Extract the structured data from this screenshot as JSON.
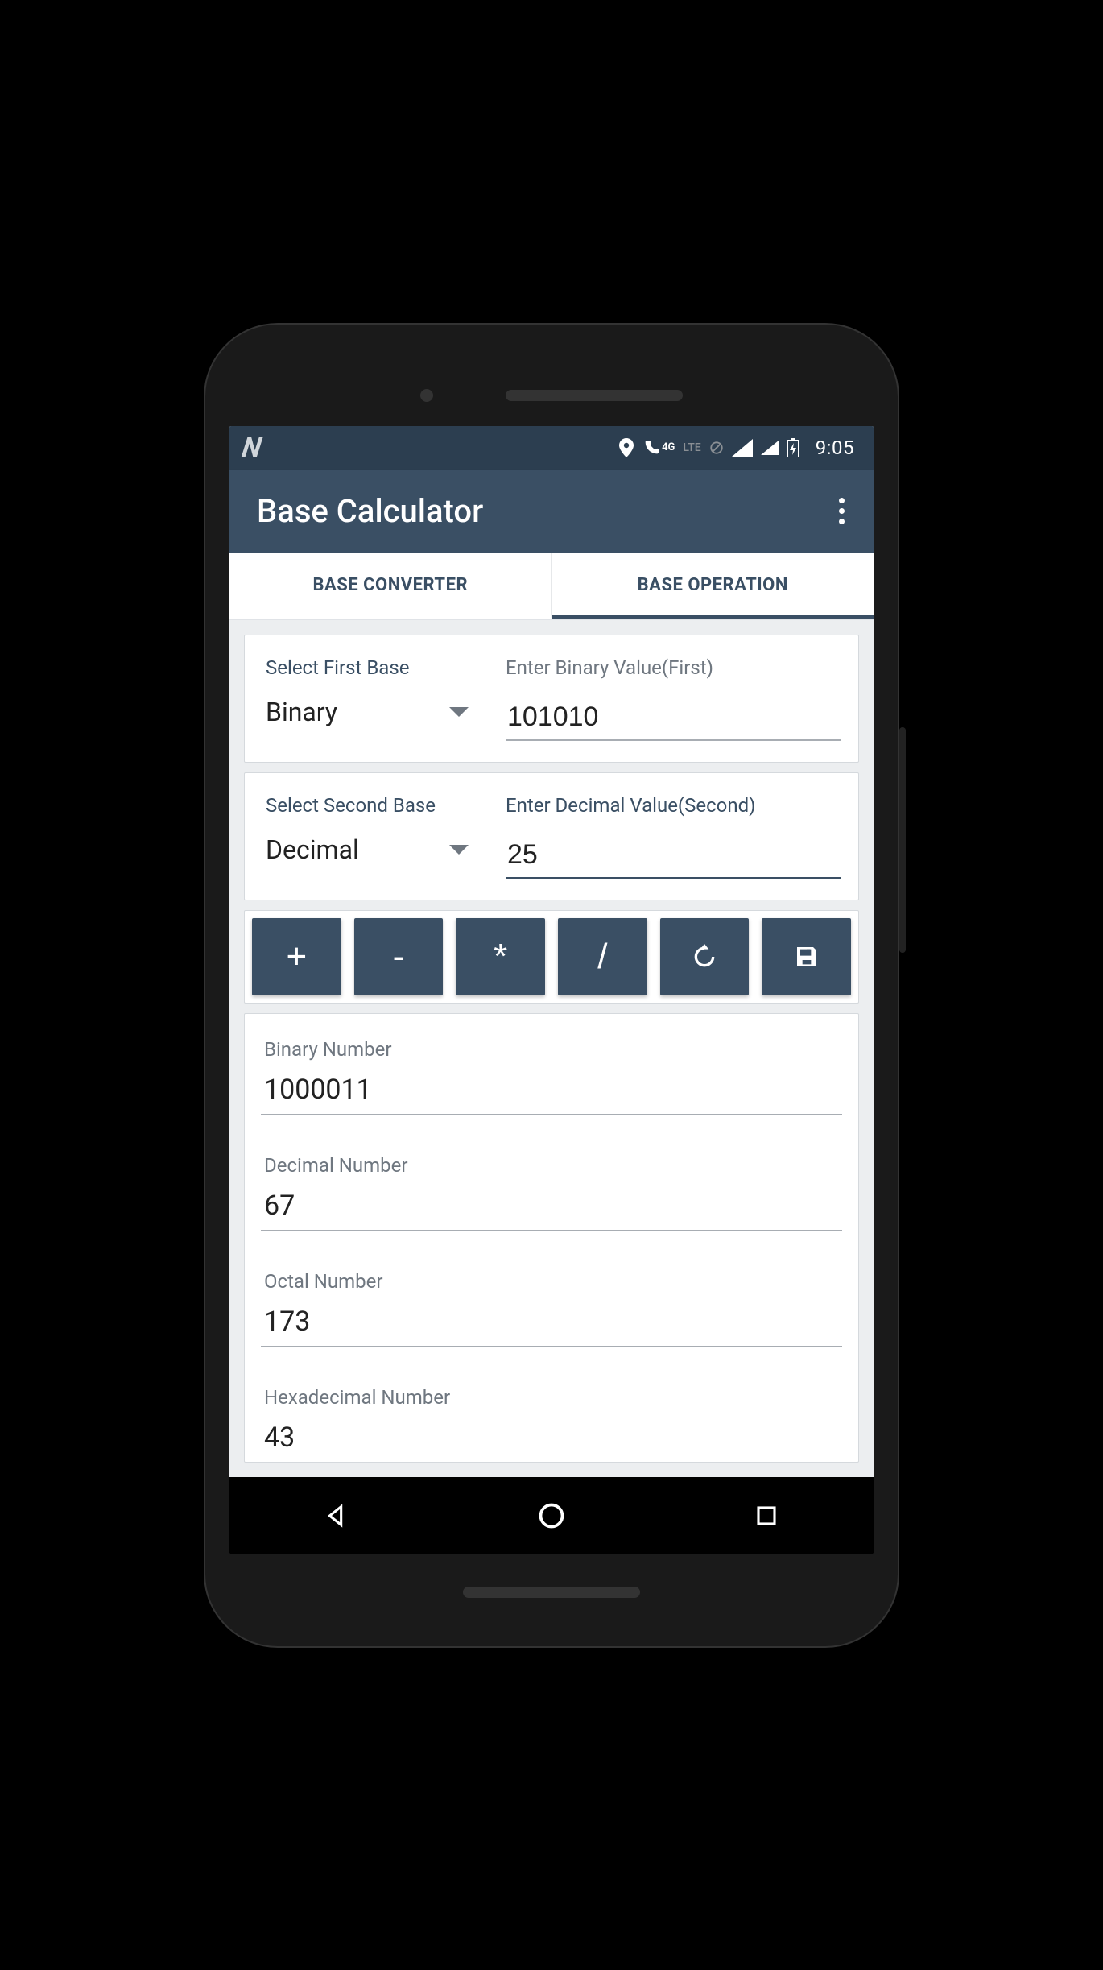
{
  "status": {
    "carrier_glyph": "N",
    "lte_label": "LTE",
    "time": "9:05"
  },
  "app_bar": {
    "title": "Base Calculator"
  },
  "tabs": [
    {
      "label": "BASE CONVERTER",
      "active": false
    },
    {
      "label": "BASE OPERATION",
      "active": true
    }
  ],
  "first_base": {
    "select_label": "Select First Base",
    "select_value": "Binary",
    "input_label": "Enter Binary Value(First)",
    "input_value": "101010"
  },
  "second_base": {
    "select_label": "Select Second Base",
    "select_value": "Decimal",
    "input_label": "Enter Decimal Value(Second)",
    "input_value": "25"
  },
  "operations": {
    "add": "+",
    "subtract": "-",
    "multiply": "*",
    "divide": "/"
  },
  "results": {
    "binary_label": "Binary Number",
    "binary_value": "1000011",
    "decimal_label": "Decimal Number",
    "decimal_value": "67",
    "octal_label": "Octal Number",
    "octal_value": "173",
    "hex_label": "Hexadecimal Number",
    "hex_value": "43"
  }
}
